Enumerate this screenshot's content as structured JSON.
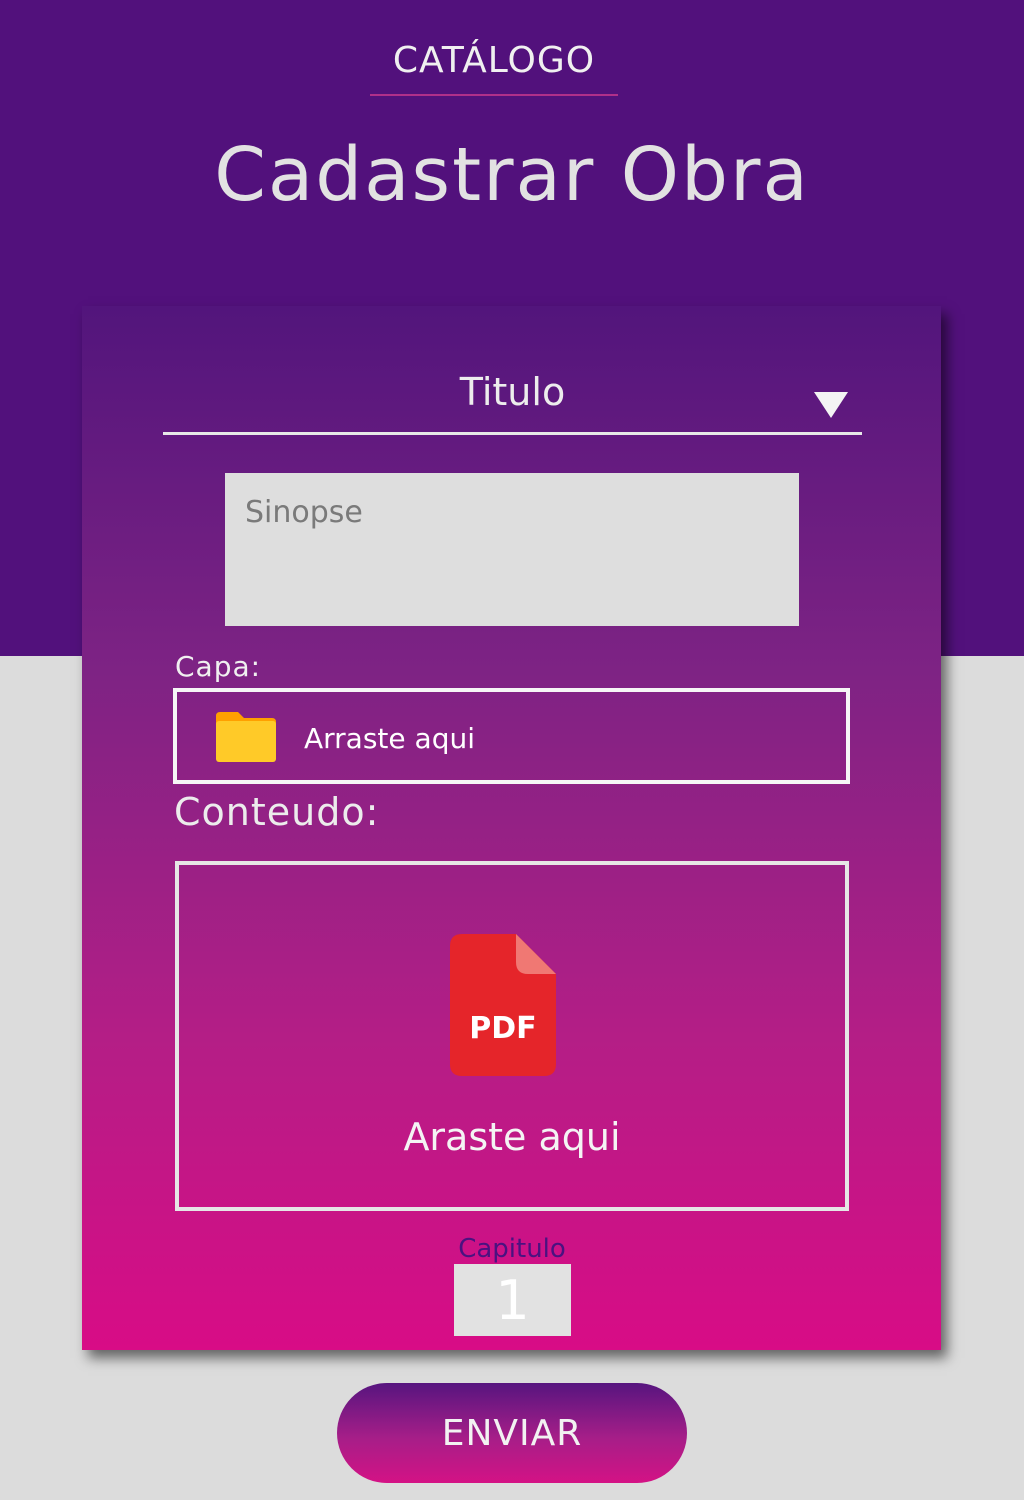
{
  "header": {
    "nav_label": "CATÁLOGO",
    "title": "Cadastrar Obra",
    "background_color": "#52117c"
  },
  "form": {
    "titulo": {
      "label": "Titulo",
      "icon": "triangle-down-icon"
    },
    "sinopse": {
      "placeholder": "Sinopse",
      "value": ""
    },
    "capa": {
      "label": "Capa:",
      "drop_text": "Arraste aqui",
      "icon": "folder-icon",
      "icon_color": "#ffca28"
    },
    "conteudo": {
      "label": "Conteudo:",
      "drop_text": "Araste aqui",
      "icon": "pdf-file-icon",
      "icon_text": "PDF",
      "icon_color": "#e5252a"
    },
    "capitulo": {
      "label": "Capitulo",
      "value": "1"
    }
  },
  "submit": {
    "label": "ENVIAR"
  },
  "colors": {
    "page_background": "#dcdcdc",
    "card_gradient_top": "#52157c",
    "card_gradient_bottom": "#d80c86",
    "accent_underline": "#b0308a"
  }
}
